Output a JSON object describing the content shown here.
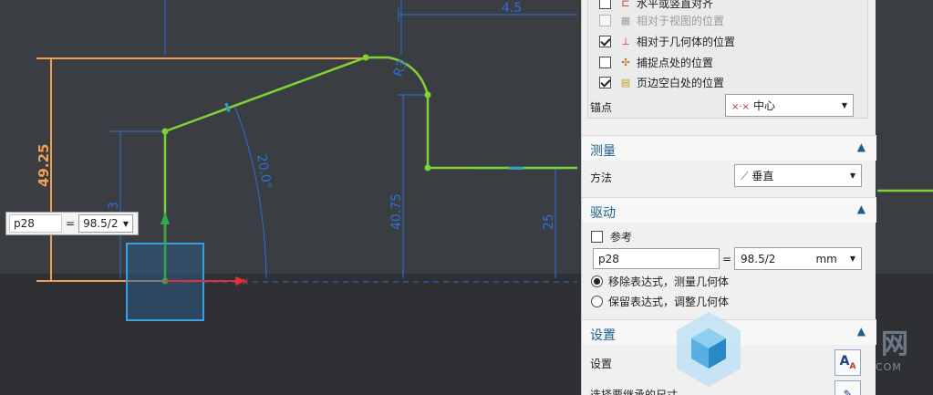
{
  "canvas": {
    "dims": {
      "top": "4.5",
      "radius": "R3",
      "angle": "20.0°",
      "height_40": "40.75",
      "height_25": "25",
      "height_orange": "49.25",
      "height_left": "3"
    },
    "inline_edit": {
      "name": "p28",
      "equals": "=",
      "value": "98.5/2"
    },
    "colors": {
      "background": "#3a3d42",
      "sketch_green": "#7fd134",
      "dim_blue": "#2f6fd4",
      "orange": "#f0a050",
      "axis_red": "#e03030"
    }
  },
  "panel": {
    "options": [
      {
        "label": "水平或竖直对齐",
        "checked": false,
        "disabled": false,
        "icon": "align-icon"
      },
      {
        "label": "相对于视图的位置",
        "checked": false,
        "disabled": true,
        "icon": "view-position-icon"
      },
      {
        "label": "相对于几何体的位置",
        "checked": true,
        "disabled": false,
        "icon": "geometry-position-icon"
      },
      {
        "label": "捕捉点处的位置",
        "checked": false,
        "disabled": false,
        "icon": "snap-point-icon"
      },
      {
        "label": "页边空白处的位置",
        "checked": true,
        "disabled": false,
        "icon": "margin-position-icon"
      }
    ],
    "anchor": {
      "label": "锚点",
      "value": "中心"
    },
    "measure": {
      "title": "测量",
      "method_label": "方法",
      "method_value": "垂直"
    },
    "drive": {
      "title": "驱动",
      "reference_label": "参考",
      "param_name": "p28",
      "equals": "=",
      "param_value": "98.5/2",
      "unit": "mm",
      "radio_1": "移除表达式，测量几何体",
      "radio_2": "保留表达式，调整几何体"
    },
    "settings": {
      "title": "设置",
      "settings_label": "设置",
      "inherit_label": "选择要继承的尺寸"
    }
  },
  "watermark": {
    "text": "网",
    "com": "COM"
  }
}
